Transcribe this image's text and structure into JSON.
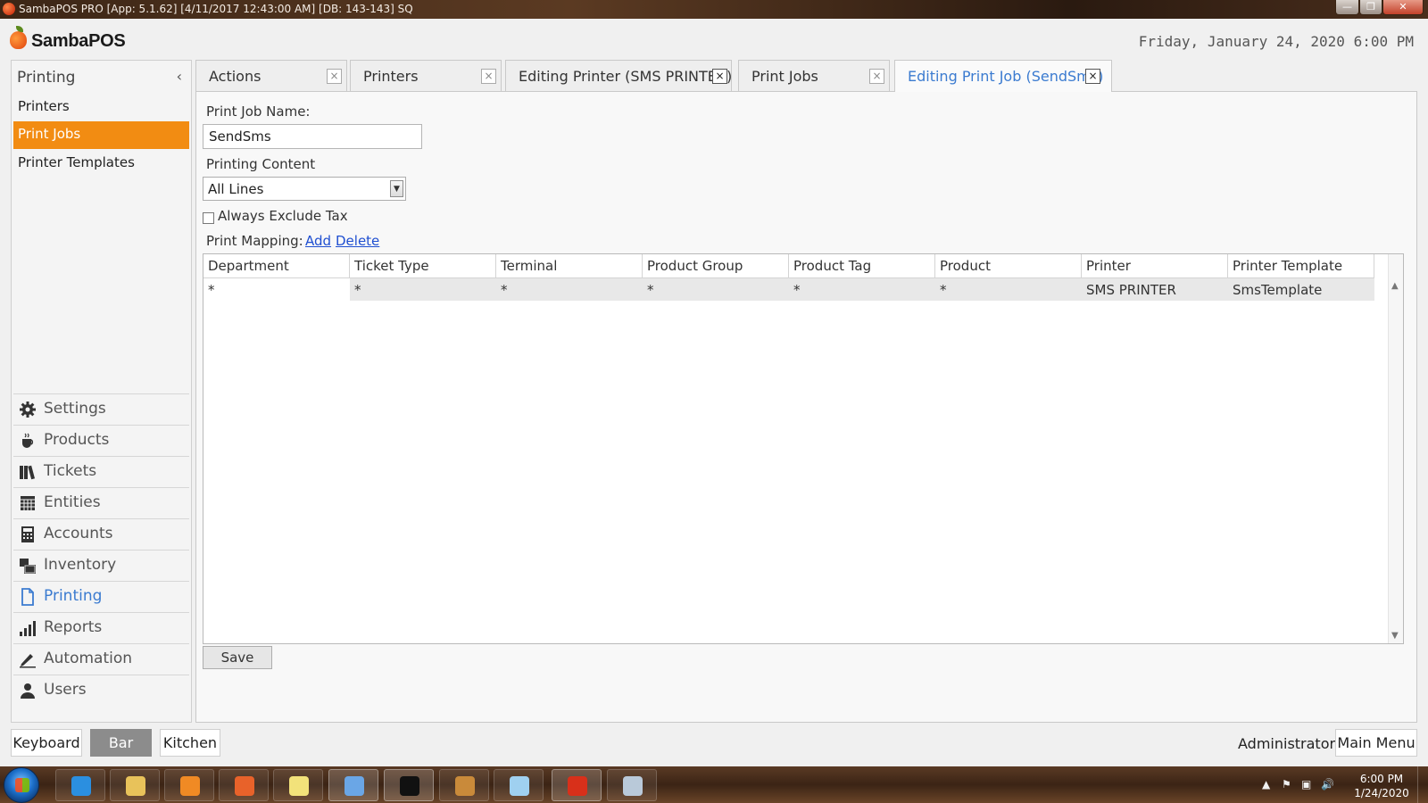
{
  "window": {
    "title": "SambaPOS PRO [App: 5.1.62] [4/11/2017 12:43:00 AM] [DB: 143-143] SQ",
    "minimize_glyph": "—",
    "maximize_glyph": "❐",
    "close_glyph": "✕"
  },
  "header": {
    "logo_text": "SambaPOS",
    "clock": "Friday, January 24, 2020 6:00 PM"
  },
  "sidebar": {
    "title": "Printing",
    "collapse_glyph": "‹",
    "sub_items": [
      {
        "label": "Printers",
        "active": false
      },
      {
        "label": "Print Jobs",
        "active": true
      },
      {
        "label": "Printer Templates",
        "active": false
      }
    ],
    "nav_items": [
      {
        "label": "Settings",
        "icon": "gear-icon"
      },
      {
        "label": "Products",
        "icon": "coffee-cup-icon"
      },
      {
        "label": "Tickets",
        "icon": "books-icon"
      },
      {
        "label": "Entities",
        "icon": "table-grid-icon"
      },
      {
        "label": "Accounts",
        "icon": "calculator-icon"
      },
      {
        "label": "Inventory",
        "icon": "boxes-icon"
      },
      {
        "label": "Printing",
        "icon": "document-icon",
        "current": true
      },
      {
        "label": "Reports",
        "icon": "bar-chart-icon"
      },
      {
        "label": "Automation",
        "icon": "pen-icon"
      },
      {
        "label": "Users",
        "icon": "user-icon"
      }
    ]
  },
  "tabs": [
    {
      "label": "Actions",
      "close": "×"
    },
    {
      "label": "Printers",
      "close": "×"
    },
    {
      "label": "Editing Printer (SMS PRINTER)",
      "close": "×"
    },
    {
      "label": "Print Jobs",
      "close": "×"
    },
    {
      "label": "Editing Print Job (SendSms)",
      "close": "×",
      "active": true
    }
  ],
  "form": {
    "job_name_label": "Print Job Name:",
    "job_name_value": "SendSms",
    "printing_content_label": "Printing Content",
    "printing_content_value": "All Lines",
    "select_arrow": "▼",
    "exclude_tax_label": "Always Exclude Tax",
    "exclude_tax_checked": false,
    "mapping_label": "Print Mapping:",
    "add_link": "Add",
    "delete_link": "Delete",
    "save_label": "Save"
  },
  "mapping_grid": {
    "columns": [
      "Department",
      "Ticket Type",
      "Terminal",
      "Product Group",
      "Product Tag",
      "Product",
      "Printer",
      "Printer Template"
    ],
    "rows": [
      [
        "*",
        "*",
        "*",
        "*",
        "*",
        "*",
        "SMS PRINTER",
        "SmsTemplate"
      ]
    ],
    "scroll_up": "▲",
    "scroll_down": "▼"
  },
  "bottom_bar": {
    "buttons": [
      {
        "label": "Keyboard",
        "selected": false
      },
      {
        "label": "Bar",
        "selected": true
      },
      {
        "label": "Kitchen",
        "selected": false
      }
    ],
    "user": "Administrator",
    "main_menu": "Main Menu"
  },
  "taskbar": {
    "apps": [
      {
        "name": "internet-explorer",
        "color": "#2b8fe0"
      },
      {
        "name": "file-explorer",
        "color": "#e8c25a"
      },
      {
        "name": "media-player",
        "color": "#f08a24"
      },
      {
        "name": "firefox",
        "color": "#e8622a"
      },
      {
        "name": "sticky-notes",
        "color": "#f2e27a"
      },
      {
        "name": "remote-desktop",
        "color": "#6aa6e6"
      },
      {
        "name": "command-prompt",
        "color": "#111111"
      },
      {
        "name": "tablet-app",
        "color": "#c98a3a"
      },
      {
        "name": "notepad-app",
        "color": "#9fd0f0"
      },
      {
        "name": "sambapos",
        "color": "#d8301a"
      },
      {
        "name": "paint",
        "color": "#b9c9d9"
      }
    ],
    "tray_glyphs": [
      "▲",
      "⚑",
      "▣",
      "🔊"
    ],
    "time": "6:00 PM",
    "date": "1/24/2020"
  }
}
